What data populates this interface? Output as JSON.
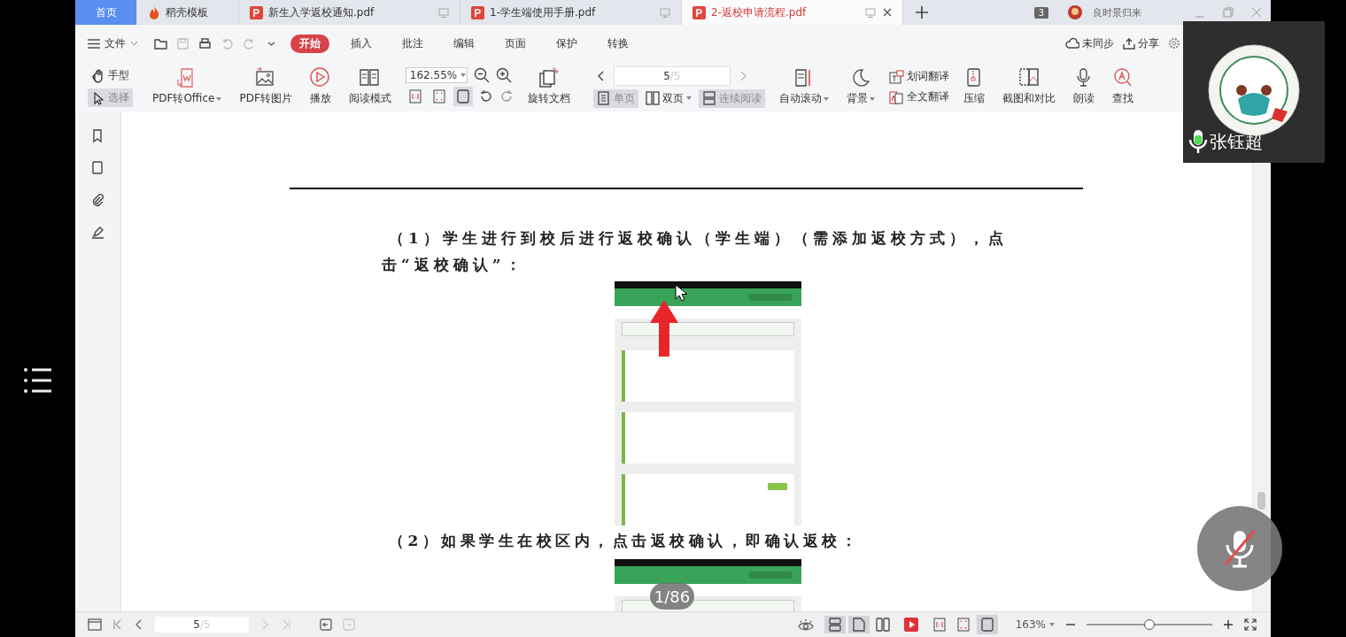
{
  "tabs": [
    {
      "kind": "home",
      "label": "首页",
      "selected": false
    },
    {
      "kind": "template",
      "label": "稻壳模板",
      "selected": false
    },
    {
      "kind": "pdf",
      "label": "新生入学返校通知.pdf",
      "selected": false
    },
    {
      "kind": "pdf",
      "label": "1-学生端使用手册.pdf",
      "selected": false
    },
    {
      "kind": "pdf",
      "label": "2-返校申请流程.pdf",
      "selected": true
    }
  ],
  "window_count": "3",
  "user": "良时景归来",
  "menu": {
    "file": "文件",
    "items": [
      {
        "label": "开始",
        "selected": true
      },
      {
        "label": "插入",
        "selected": false
      },
      {
        "label": "批注",
        "selected": false
      },
      {
        "label": "编辑",
        "selected": false
      },
      {
        "label": "页面",
        "selected": false
      },
      {
        "label": "保护",
        "selected": false
      },
      {
        "label": "转换",
        "selected": false
      }
    ],
    "sync": "未同步",
    "share": "分享"
  },
  "toolbar": {
    "modes": [
      {
        "label": "手型",
        "selected": false
      },
      {
        "label": "选择",
        "selected": true
      }
    ],
    "tools_left": [
      {
        "label": "PDF转Office",
        "dropdown": true
      },
      {
        "label": "PDF转图片",
        "dropdown": false
      },
      {
        "label": "播放",
        "dropdown": false
      },
      {
        "label": "阅读模式",
        "dropdown": false
      }
    ],
    "zoom": "162.55%",
    "fit_buttons": [
      {
        "selected": false
      },
      {
        "selected": false
      },
      {
        "selected": true
      }
    ],
    "rotate": "旋转文档",
    "page": "5",
    "page_total": "/5",
    "views": [
      {
        "label": "单页",
        "selected": true,
        "dropdown": false
      },
      {
        "label": "双页",
        "selected": false,
        "dropdown": true
      },
      {
        "label": "连续阅读",
        "selected": true,
        "dropdown": false
      }
    ],
    "tools_right": [
      {
        "label": "自动滚动",
        "dropdown": true
      },
      {
        "label": "背景",
        "dropdown": true
      }
    ],
    "translate": [
      "划词翻译",
      "全文翻译"
    ],
    "tools_end": [
      {
        "label": "压缩",
        "dropdown": false
      },
      {
        "label": "截图和对比",
        "dropdown": false
      },
      {
        "label": "朗读",
        "dropdown": false
      },
      {
        "label": "查找",
        "dropdown": false
      }
    ]
  },
  "document": {
    "paragraphs": [
      "（1）学生进行到校后进行返校确认（学生端）（需添加返校方式），点击“返校确认”：",
      "（2）如果学生在校区内，点击返校确认，即确认返校："
    ]
  },
  "status_bar": {
    "page": "5",
    "page_total": "/5",
    "layouts": [
      {
        "selected": true
      },
      {
        "selected": true
      },
      {
        "selected": false
      }
    ],
    "fits": [
      {
        "selected": false
      },
      {
        "selected": false
      },
      {
        "selected": true
      }
    ],
    "zoom": "163%",
    "level": 0.5
  },
  "page_counter": "1/86",
  "participant": {
    "name": "张钰超"
  }
}
